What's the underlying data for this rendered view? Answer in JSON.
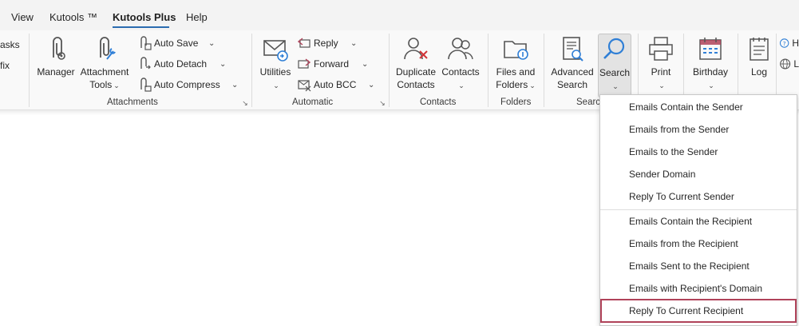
{
  "tabs": [
    {
      "label": "View",
      "active": false
    },
    {
      "label": "Kutools ™",
      "active": false
    },
    {
      "label": "Kutools Plus",
      "active": true
    },
    {
      "label": "Help",
      "active": false
    }
  ],
  "left_cut": {
    "line1": "asks",
    "line2": "fix"
  },
  "right_cut": {
    "line1": "H",
    "line2": "L"
  },
  "groups": {
    "attachments": {
      "label": "Attachments",
      "manager": "Manager",
      "attachment_tools_1": "Attachment",
      "attachment_tools_2": "Tools",
      "auto_save": "Auto Save",
      "auto_detach": "Auto Detach",
      "auto_compress": "Auto Compress"
    },
    "automatic": {
      "label": "Automatic",
      "utilities": "Utilities",
      "reply": "Reply",
      "forward": "Forward",
      "auto_bcc": "Auto BCC"
    },
    "contacts": {
      "label": "Contacts",
      "duplicate_1": "Duplicate",
      "duplicate_2": "Contacts",
      "contacts": "Contacts"
    },
    "folders": {
      "label": "Folders",
      "files_1": "Files and",
      "files_2": "Folders"
    },
    "search": {
      "label_visible": "Searc",
      "advanced_1": "Advanced",
      "advanced_2": "Search",
      "search": "Search"
    },
    "other": {
      "print": "Print",
      "birthday": "Birthday",
      "log": "Log"
    }
  },
  "search_menu": {
    "items": [
      "Emails Contain the Sender",
      "Emails from the Sender",
      "Emails to the Sender",
      "Sender Domain",
      "Reply To Current Sender",
      "Emails Contain the Recipient",
      "Emails from the Recipient",
      "Emails Sent to the Recipient",
      "Emails with Recipient's Domain",
      "Reply To Current Recipient"
    ],
    "highlighted_index": 9
  },
  "colors": {
    "accent": "#2b6cb0",
    "highlight_border": "#b0435a",
    "icon_blue": "#2f7fd6",
    "icon_red": "#d13438",
    "icon_gray": "#555555"
  },
  "icons": {
    "manager": "paperclip-gear-icon",
    "attachment_tools": "paperclip-wrench-icon",
    "utilities": "envelope-arrow-icon",
    "duplicate_contacts": "people-x-icon",
    "contacts": "people-icon",
    "files_folders": "folder-icon",
    "advanced_search": "document-search-icon",
    "search": "magnifier-icon",
    "print": "printer-icon",
    "birthday": "calendar-icon",
    "log": "notepad-icon"
  }
}
